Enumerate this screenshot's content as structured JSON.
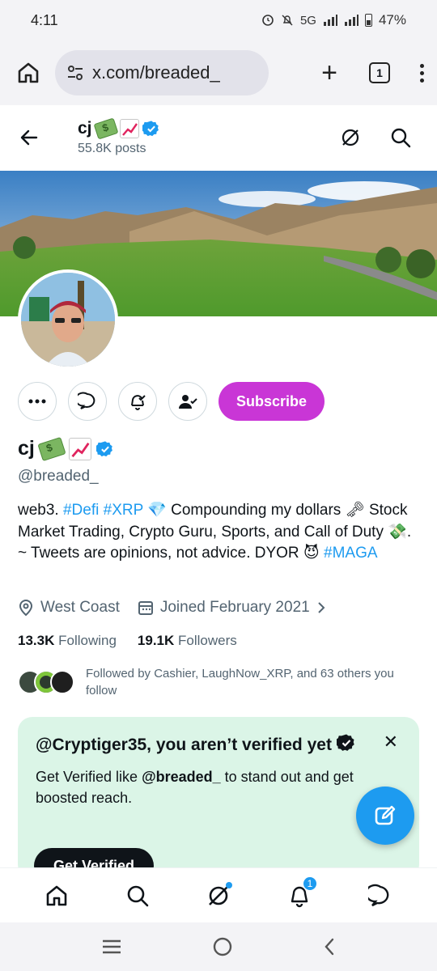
{
  "status_bar": {
    "time": "4:11",
    "network": "5G",
    "battery_pct": "47%"
  },
  "browser": {
    "url": "x.com/breaded_",
    "tab_count": "1",
    "icons": [
      "home-icon",
      "tune-icon",
      "plus-icon",
      "tabs-icon",
      "more-vertical-icon"
    ]
  },
  "topnav": {
    "name": "cj",
    "posts": "55.8K posts"
  },
  "profile": {
    "name": "cj",
    "handle": "@breaded_",
    "subscribe_label": "Subscribe",
    "bio": {
      "p1": "web3. ",
      "tag_defi": "#Defi",
      "sp1": " ",
      "tag_xrp": "#XRP",
      "p2": " 💎 Compounding my dollars 🗝 Stock Market Trading, Crypto Guru, Sports, and Call of Duty 💸. ~ Tweets are opinions, not advice. DYOR 😈 ",
      "tag_maga": "#MAGA"
    },
    "location": "West Coast",
    "joined": "Joined February 2021",
    "following_count": "13.3K",
    "following_label": "Following",
    "followers_count": "19.1K",
    "followers_label": "Followers",
    "followed_by": "Followed by Cashier, LaughNow_XRP, and 63 others you follow"
  },
  "verify_card": {
    "title": "@Cryptiger35, you aren’t verified yet",
    "body_pre": "Get Verified like ",
    "body_handle": "@breaded_",
    "body_post": " to stand out and get boosted reach.",
    "button": "Get Verified",
    "close": "✕"
  },
  "bottom_nav": {
    "notifications_badge": "1"
  },
  "colors": {
    "accent": "#1d9bf0",
    "subscribe": "#c936d6",
    "verify_card_bg": "#dbf5e7",
    "text_secondary": "#536471"
  }
}
